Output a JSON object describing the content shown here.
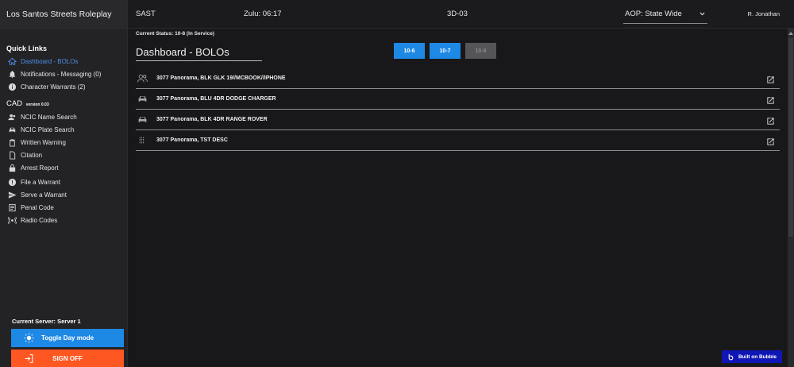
{
  "app": {
    "title": "Los Santos Streets Roleplay"
  },
  "header": {
    "timezone": "SAST",
    "zulu": "Zulu: 06:17",
    "unit": "3D-03",
    "aop": "AOP: State Wide",
    "user": "R. Jonathan"
  },
  "sidebar": {
    "quick_links_title": "Quick Links",
    "quick_links": [
      {
        "label": "Dashboard - BOLOs",
        "icon": "home-icon"
      },
      {
        "label": "Notifications - Messaging (0)",
        "icon": "bell-icon"
      },
      {
        "label": "Character Warrants (2)",
        "icon": "info-icon"
      }
    ],
    "cad_title": "CAD",
    "cad_version": "version 0.03",
    "cad_links": [
      {
        "label": "NCIC Name Search",
        "icon": "users-icon"
      },
      {
        "label": "NCIC Plate Search",
        "icon": "car-icon"
      },
      {
        "label": "Written Warning",
        "icon": "clipboard-icon"
      },
      {
        "label": "Citation",
        "icon": "file-icon"
      },
      {
        "label": "Arrest Report",
        "icon": "lock-icon"
      },
      {
        "label": "File a Warrant",
        "icon": "alert-icon"
      },
      {
        "label": "Serve a Warrant",
        "icon": "send-icon"
      },
      {
        "label": "Penal Code",
        "icon": "document-icon"
      },
      {
        "label": "Radio Codes",
        "icon": "radio-icon"
      }
    ],
    "current_server": "Current Server: Server 1",
    "toggle_label": "Toggle Day mode",
    "signoff_label": "SIGN OFF"
  },
  "main": {
    "status": "Current Status: 10-8 (In Service)",
    "title": "Dashboard - BOLOs",
    "codes": [
      "10-6",
      "10-7",
      "10-8"
    ],
    "bolos": [
      {
        "text": "3077 Panorama, BLK GLK 19//MCBOOK//IPHONE",
        "icon": "people-icon"
      },
      {
        "text": "3077 Panorama, BLU 4DR DODGE CHARGER",
        "icon": "car-icon"
      },
      {
        "text": "3077 Panorama, BLK 4DR RANGE ROVER",
        "icon": "car-icon"
      },
      {
        "text": "3077 Panorama, TST DESC",
        "icon": "grid-icon"
      }
    ]
  },
  "footer": {
    "bubble": "Built on Bubble"
  },
  "colors": {
    "accent": "#1e88e5",
    "danger": "#ff5722",
    "active_link": "#4f8fe6",
    "bubble": "#0f16b5"
  }
}
